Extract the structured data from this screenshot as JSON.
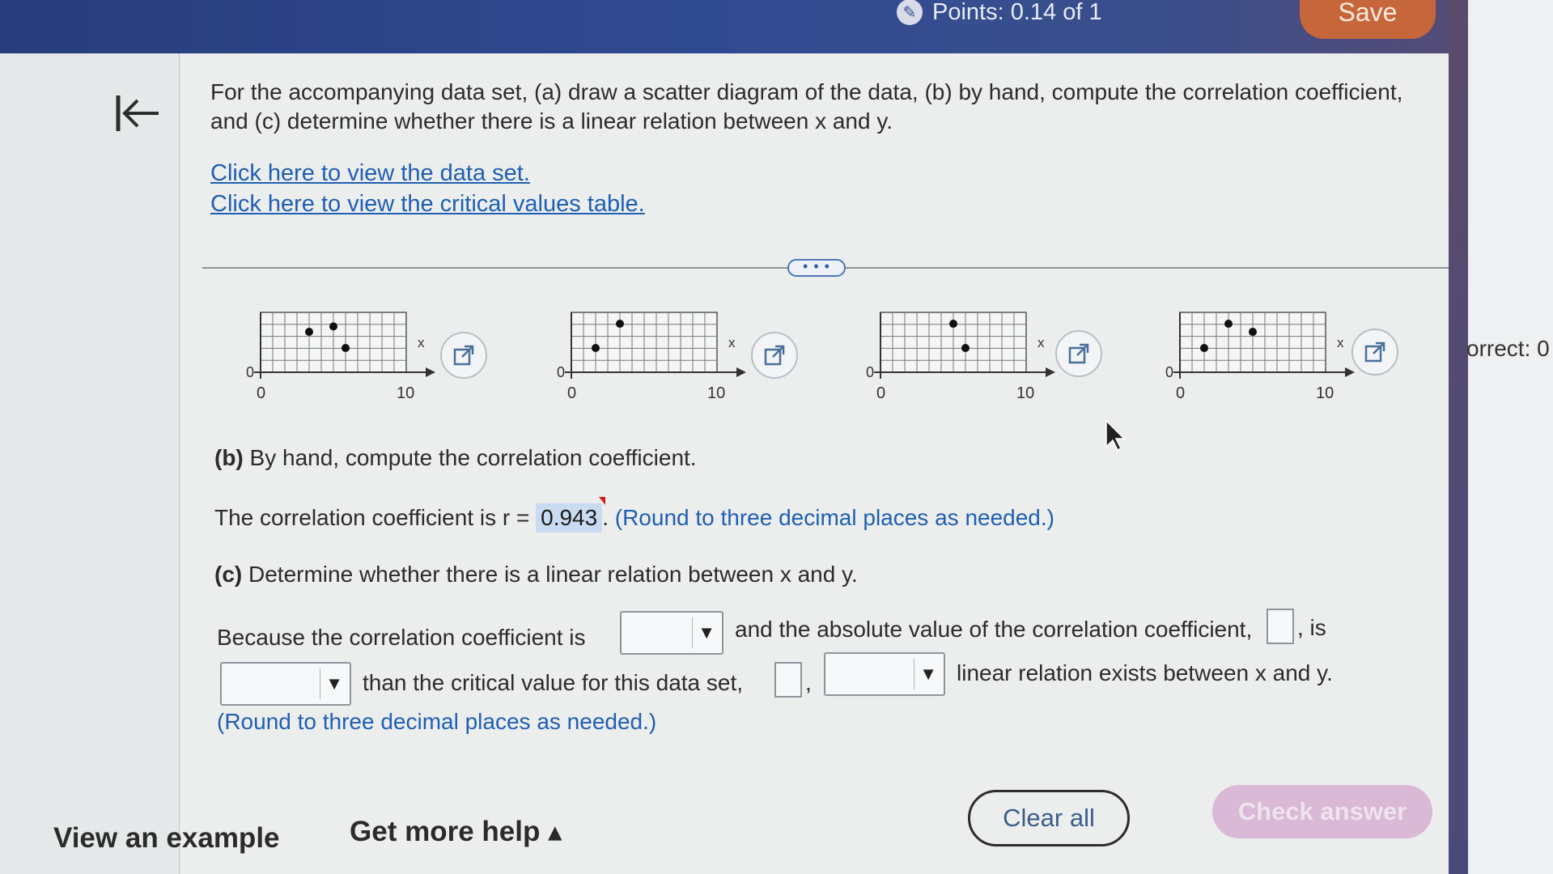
{
  "header": {
    "points_label": "Points: 0.14 of 1",
    "save_label": "Save"
  },
  "right_panel": {
    "partial_label": "orrect: 0"
  },
  "question": {
    "text": "For the accompanying data set, (a) draw a scatter diagram of the data, (b) by hand, compute the correlation coefficient, and (c) determine whether there is a linear relation between x and y.",
    "link_data_set": "Click here to view the data set.",
    "link_critical_values": "Click here to view the critical values table."
  },
  "handle_label": "• • •",
  "graphs": [
    {
      "y_tick": "0",
      "x_label": "x",
      "x_start": "0",
      "x_end": "10",
      "points": [
        [
          4,
          3
        ],
        [
          6,
          3.4
        ],
        [
          7,
          1.8
        ]
      ]
    },
    {
      "y_tick": "0",
      "x_label": "x",
      "x_start": "0",
      "x_end": "10",
      "points": [
        [
          2,
          1.8
        ],
        [
          4,
          3.6
        ]
      ]
    },
    {
      "y_tick": "0",
      "x_label": "x",
      "x_start": "0",
      "x_end": "10",
      "points": [
        [
          6,
          3.6
        ],
        [
          7,
          1.8
        ]
      ]
    },
    {
      "y_tick": "0",
      "x_label": "x",
      "x_start": "0",
      "x_end": "10",
      "points": [
        [
          2,
          1.8
        ],
        [
          4,
          3.6
        ],
        [
          6,
          3
        ]
      ]
    }
  ],
  "part_b": {
    "label": "(b)",
    "instruction": "By hand, compute the correlation coefficient.",
    "prefix": "The correlation coefficient is r =",
    "value": "0.943",
    "suffix": ".",
    "hint": "(Round to three decimal places as needed.)"
  },
  "part_c": {
    "label": "(c)",
    "instruction": "Determine whether there is a linear relation between x and y.",
    "line1_a": "Because the correlation coefficient is",
    "line1_b": "and the absolute value of the correlation coefficient,",
    "line1_c": ", is",
    "line2_a": "than the critical value for this data set,",
    "line2_b": ",",
    "line2_c": "linear relation exists between x and y.",
    "hint": "(Round to three decimal places as needed.)"
  },
  "footer": {
    "view_example": "View an example",
    "get_more_help": "Get more help ▴",
    "clear_all": "Clear all",
    "check_answer": "Check answer"
  },
  "colors": {
    "header_blue": "#304a91",
    "save_orange": "#c5673a",
    "link_blue": "#1f5fb3",
    "answer_highlight": "#c8dbf0",
    "check_button": "#d9b9d6"
  }
}
